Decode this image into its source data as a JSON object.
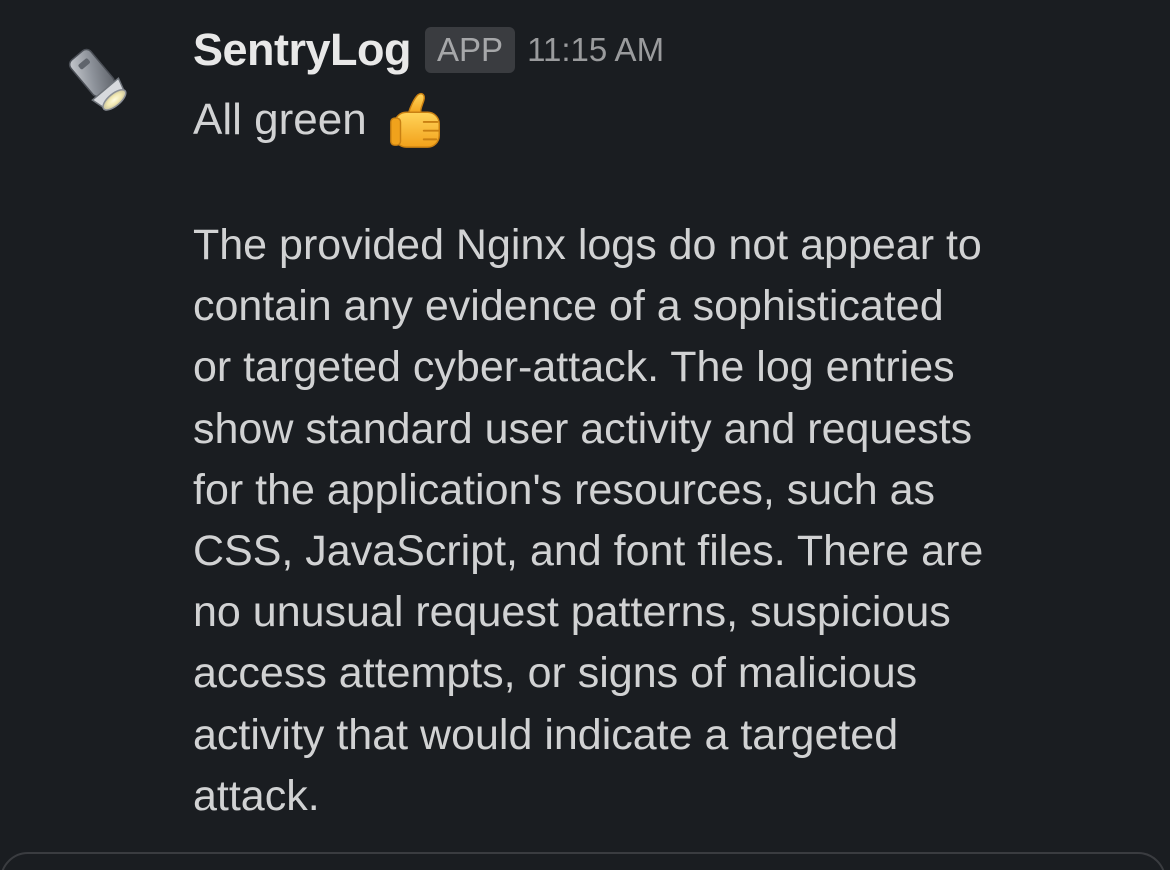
{
  "message": {
    "avatar_icon": "flashlight-icon",
    "sender": "SentryLog",
    "badge": "APP",
    "timestamp": "11:15 AM",
    "headline": "All green",
    "headline_emoji": "thumbs-up-icon",
    "body_lines": [
      "The provided Nginx logs do not appear to",
      "contain any evidence of a sophisticated",
      "or targeted cyber-attack. The log entries",
      "show standard user activity and requests",
      "for the application's resources, such as",
      "CSS, JavaScript, and font files. There are",
      "no unusual request patterns, suspicious",
      "access attempts, or signs of malicious",
      "activity that would indicate a targeted",
      "attack."
    ]
  },
  "colors": {
    "background": "#1a1d21",
    "text": "#d1d2d3",
    "sender": "#e8e8e8",
    "badge_bg": "#3a3c40",
    "muted": "#9a9b9d"
  }
}
